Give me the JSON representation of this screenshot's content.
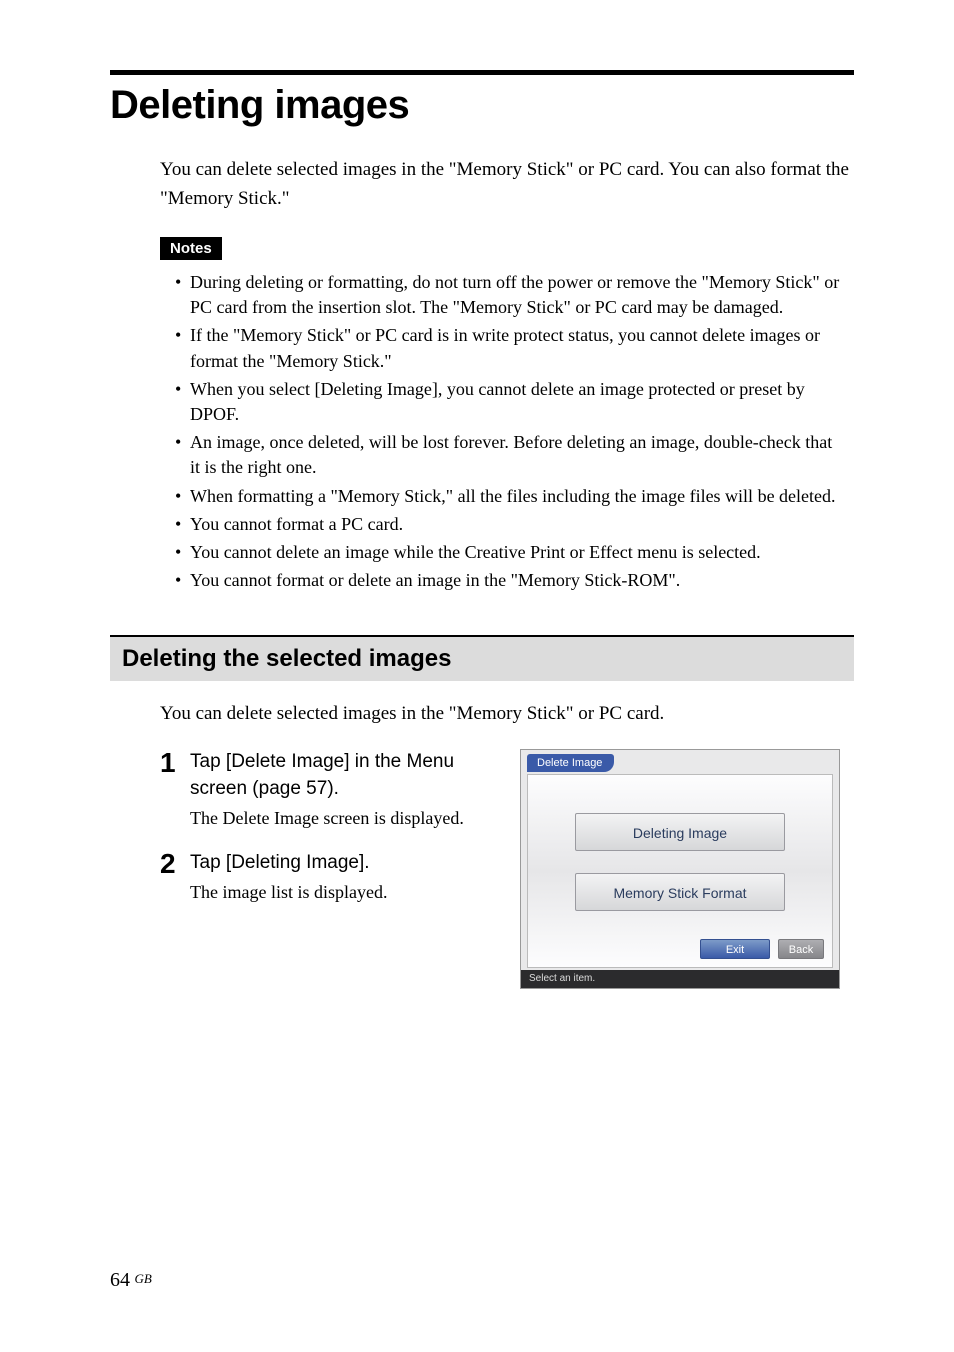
{
  "title": "Deleting images",
  "intro": "You can delete selected images in the \"Memory Stick\" or PC card. You can also format the \"Memory Stick.\"",
  "notes_label": "Notes",
  "notes": [
    "During deleting or formatting, do not turn off the power or remove the \"Memory Stick\" or PC card from the insertion slot.  The \"Memory Stick\" or PC card may be damaged.",
    "If the \"Memory Stick\" or PC card is in write protect status, you cannot delete images or format the \"Memory Stick.\"",
    "When you select [Deleting Image], you cannot delete an image protected or preset by DPOF.",
    "An image, once deleted, will be lost forever. Before deleting an image, double-check that it is the right one.",
    "When formatting a \"Memory Stick,\" all the files including the image files will be deleted.",
    "You cannot format a PC card.",
    "You cannot delete an image while the Creative Print or Effect menu is selected.",
    "You cannot format or delete an image in the \"Memory Stick-ROM\"."
  ],
  "subheader": "Deleting the selected images",
  "sub_intro": "You can delete selected images in the \"Memory Stick\" or PC card.",
  "steps": [
    {
      "num": "1",
      "title": "Tap [Delete Image] in the Menu screen (page 57).",
      "desc": "The Delete Image screen is displayed."
    },
    {
      "num": "2",
      "title": "Tap [Deleting Image].",
      "desc": "The image list is displayed."
    }
  ],
  "screenshot": {
    "tab": "Delete Image",
    "button1": "Deleting Image",
    "button2": "Memory Stick Format",
    "exit": "Exit",
    "back": "Back",
    "status": "Select an item."
  },
  "page_number": "64",
  "page_suffix": "GB"
}
